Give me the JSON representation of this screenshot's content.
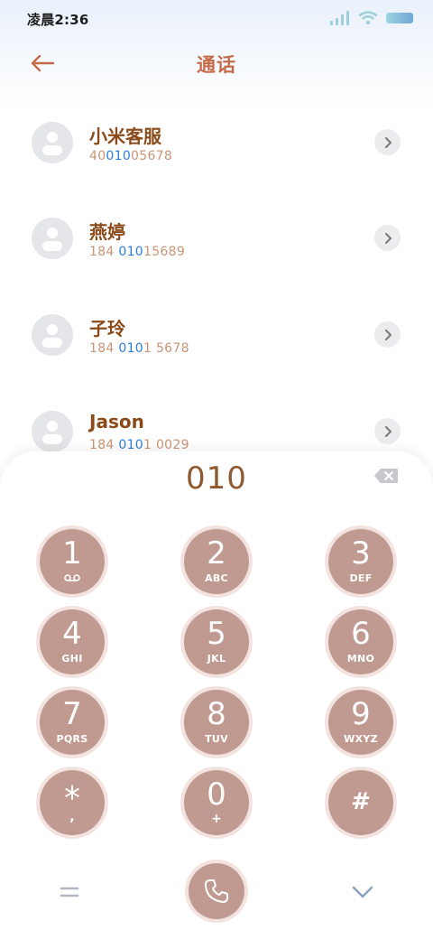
{
  "status_bar": {
    "time": "凌晨2:36",
    "icons": [
      "signal-icon",
      "wifi-icon",
      "battery-icon"
    ]
  },
  "header": {
    "title": "通话",
    "back_icon": "back-arrow-icon"
  },
  "contacts": [
    {
      "name": "小米客服",
      "number_parts": [
        "40",
        "010",
        "05678"
      ]
    },
    {
      "name": "燕婷",
      "number_parts": [
        "184 ",
        "010",
        "15689"
      ]
    },
    {
      "name": "子玲",
      "number_parts": [
        "184 ",
        "010",
        "1 5678"
      ]
    },
    {
      "name": "Jason",
      "number_parts": [
        "184 ",
        "010",
        "1 0029"
      ]
    }
  ],
  "dialpad": {
    "dialed": "010",
    "keys": [
      {
        "digit": "1",
        "letters": ""
      },
      {
        "digit": "2",
        "letters": "ABC"
      },
      {
        "digit": "3",
        "letters": "DEF"
      },
      {
        "digit": "4",
        "letters": "GHI"
      },
      {
        "digit": "5",
        "letters": "JKL"
      },
      {
        "digit": "6",
        "letters": "MNO"
      },
      {
        "digit": "7",
        "letters": "PQRS"
      },
      {
        "digit": "8",
        "letters": "TUV"
      },
      {
        "digit": "9",
        "letters": "WXYZ"
      },
      {
        "digit": "*",
        "letters": ","
      },
      {
        "digit": "0",
        "letters": "+"
      },
      {
        "digit": "#",
        "letters": ""
      }
    ],
    "bottom": {
      "menu_icon": "menu-icon",
      "call_icon": "phone-icon",
      "collapse_icon": "chevron-down-icon"
    }
  },
  "colors": {
    "accent": "#c56b48",
    "name": "#8a4a1a",
    "number": "#c99576",
    "highlight": "#2b7fe0",
    "key_fill": "#c09a90"
  }
}
